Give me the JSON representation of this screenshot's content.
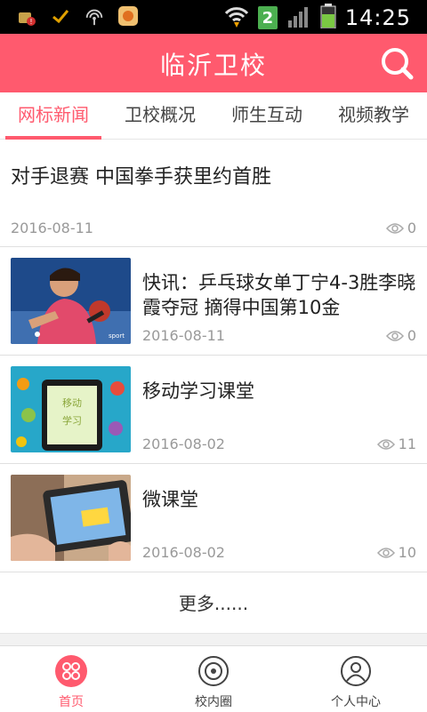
{
  "status_bar": {
    "time": "14:25",
    "sim_slot": "2"
  },
  "header": {
    "title": "临沂卫校"
  },
  "tabs": [
    {
      "label": "网标新闻",
      "active": true
    },
    {
      "label": "卫校概况",
      "active": false
    },
    {
      "label": "师生互动",
      "active": false
    },
    {
      "label": "视频教学",
      "active": false
    }
  ],
  "news": [
    {
      "title": "对手退赛 中国拳手获里约首胜",
      "date": "2016-08-11",
      "views": "0"
    },
    {
      "title": "快讯：乒乓球女单丁宁4-3胜李晓霞夺冠 摘得中国第10金",
      "date": "2016-08-11",
      "views": "0",
      "image": "table-tennis-player-photo"
    },
    {
      "title": "移动学习课堂",
      "date": "2016-08-02",
      "views": "11",
      "image": "mobile-learning-graphic"
    },
    {
      "title": "微课堂",
      "date": "2016-08-02",
      "views": "10",
      "image": "tablet-photo"
    }
  ],
  "more_label": "更多......",
  "bottom_nav": [
    {
      "label": "首页",
      "icon": "home-icon",
      "active": true
    },
    {
      "label": "校内圈",
      "icon": "circle-icon",
      "active": false
    },
    {
      "label": "个人中心",
      "icon": "user-icon",
      "active": false
    }
  ],
  "colors": {
    "accent": "#ff5a6e",
    "statusbar": "#000000"
  }
}
